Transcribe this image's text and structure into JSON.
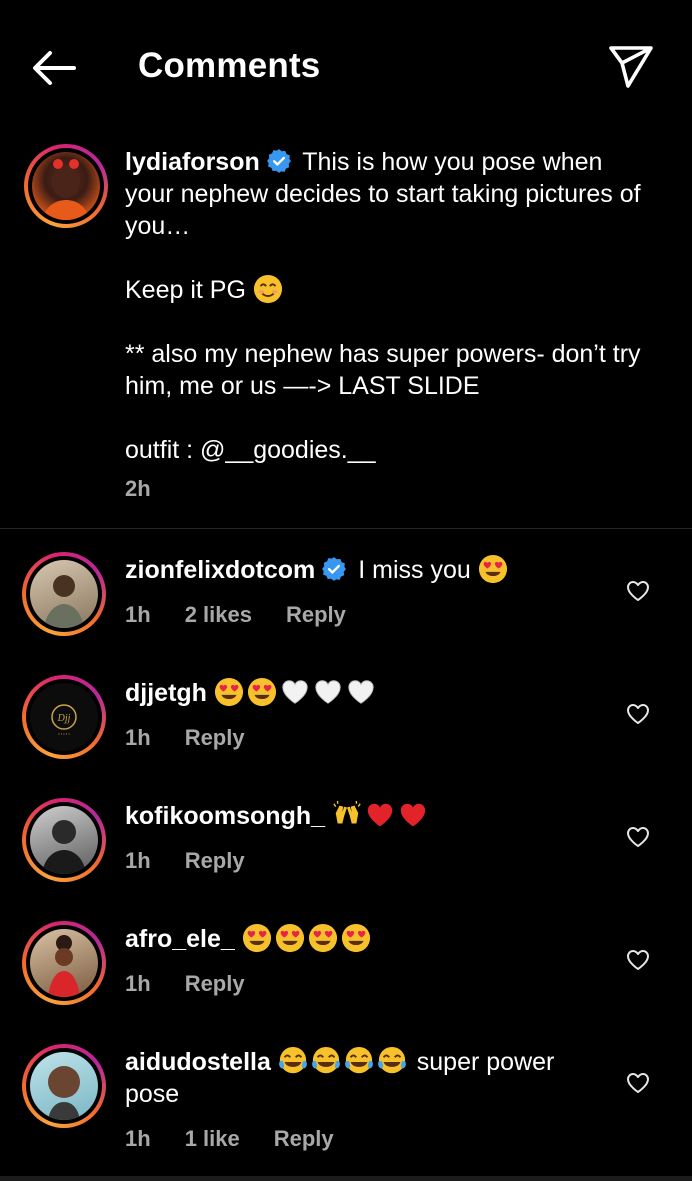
{
  "header": {
    "title": "Comments"
  },
  "caption": {
    "username": "lydiaforson",
    "line1": "This is how you pose when your nephew decides to start taking pictures of you…",
    "line2": "Keep it PG",
    "line3": "** also my nephew has super powers- don’t try him, me or us —-> LAST SLIDE",
    "line4": "outfit : @__goodies.__",
    "time": "2h"
  },
  "comments": [
    {
      "username": "zionfelixdotcom",
      "text": "I miss you",
      "time": "1h",
      "likes": "2 likes",
      "reply": "Reply"
    },
    {
      "username": "djjetgh",
      "text": "",
      "time": "1h",
      "reply": "Reply"
    },
    {
      "username": "kofikoomsongh_",
      "text": "",
      "time": "1h",
      "reply": "Reply"
    },
    {
      "username": "afro_ele_",
      "text": "",
      "time": "1h",
      "reply": "Reply"
    },
    {
      "username": "aidudostella",
      "text": "super power pose",
      "time": "1h",
      "likes": "1 like",
      "reply": "Reply"
    }
  ],
  "colors": {
    "background": "#000000",
    "secondary_text": "#a8a8a8",
    "verified": "#3897f0",
    "divider": "#262626"
  },
  "icons": [
    "back-arrow-icon",
    "send-icon",
    "verified-badge-icon",
    "heart-icon",
    "heart-eyes-emoji",
    "white-heart-emoji",
    "red-heart-emoji",
    "raised-hands-emoji",
    "tears-of-joy-emoji",
    "smiling-emoji"
  ]
}
